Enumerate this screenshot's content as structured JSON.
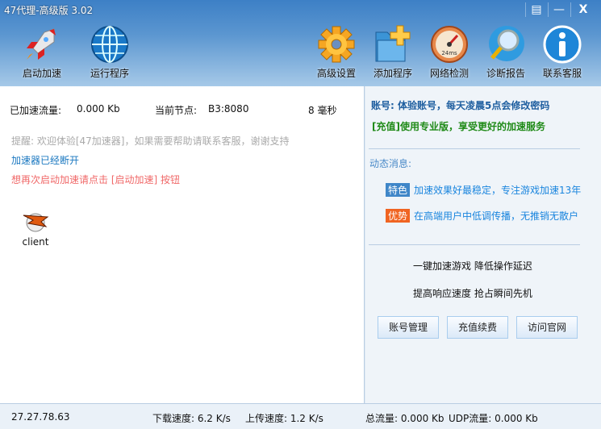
{
  "window": {
    "title": "47代理-高级版 3.02",
    "buttons": [
      "menu",
      "minimize",
      "close"
    ]
  },
  "toolbar": {
    "left": [
      {
        "label": "启动加速",
        "icon": "rocket-icon"
      },
      {
        "label": "运行程序",
        "icon": "globe-icon"
      }
    ],
    "right": [
      {
        "label": "高级设置",
        "icon": "gear-icon"
      },
      {
        "label": "添加程序",
        "icon": "folder-add-icon"
      },
      {
        "label": "网络检测",
        "icon": "speedometer-icon"
      },
      {
        "label": "诊断报告",
        "icon": "magnifier-icon"
      },
      {
        "label": "联系客服",
        "icon": "info-icon"
      }
    ],
    "speedometer_text": "24ms"
  },
  "main": {
    "traffic_label": "已加速流量:",
    "traffic_value": "0.000 Kb",
    "node_label": "当前节点:",
    "node_value": "B3:8080",
    "latency": "8 毫秒",
    "tip": "提醒: 欢迎体验[47加速器]，如果需要帮助请联系客服，谢谢支持",
    "status": "加速器已经断开",
    "hint": "想再次启动加速请点击 [启动加速] 按钮",
    "app": {
      "name": "client"
    }
  },
  "side": {
    "account": "账号: 体验账号，每天凌晨5点会修改密码",
    "promo": "[充值]使用专业版，享受更好的加速服务",
    "news_title": "动态消息:",
    "news": [
      {
        "tag": "特色",
        "text": "加速效果好最稳定，专注游戏加速13年",
        "color": "#3f86c8"
      },
      {
        "tag": "优势",
        "text": "在高端用户中低调传播，无推销无散户",
        "color": "#f06422"
      }
    ],
    "slogan1": "一键加速游戏  降低操作延迟",
    "slogan2": "提高响应速度  抢占瞬间先机",
    "buttons": [
      "账号管理",
      "充值续费",
      "访问官网"
    ]
  },
  "statusbar": {
    "ip": "27.27.78.63",
    "download": "下载速度: 6.2 K/s",
    "upload": "上传速度: 1.2 K/s",
    "total": "总流量: 0.000 Kb",
    "udp": "UDP流量: 0.000 Kb"
  }
}
